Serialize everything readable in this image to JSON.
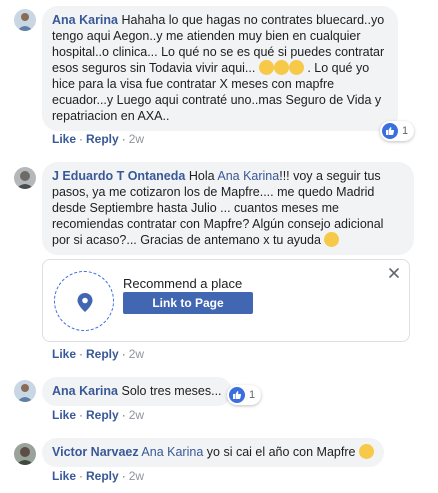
{
  "comments": [
    {
      "author": "Ana Karina",
      "text_a": "Hahaha lo que hagas no contrates bluecard..yo tengo aqui Aegon..y me atienden muy bien en cualquier hospital..o clinica... Lo qué no se es qué si puedes contratar esos seguros sin Todavia vivir aqui...",
      "text_b": ". Lo qué yo hice para la visa fue contratar X meses con mapfre ecuador...y Luego aqui contraté uno..mas Seguro de Vida y repatriacion en AXA..",
      "like_label": "Like",
      "reply_label": "Reply",
      "time": "2w",
      "reaction_count": "1"
    },
    {
      "author": "J Eduardo T Ontaneda",
      "greeting": "Hola",
      "mention": "Ana Karina",
      "text": "!!! voy a seguir tus pasos, ya me cotizaron los de Mapfre.... me quedo Madrid desde Septiembre hasta Julio ... cuantos meses me recomiendas contratar con Mapfre? Algún consejo adicional por si acaso?... Gracias de antemano x tu ayuda"
    },
    {
      "author": "Ana Karina",
      "text": "Solo tres meses...",
      "like_label": "Like",
      "reply_label": "Reply",
      "time": "2w",
      "reaction_count": "1"
    },
    {
      "author": "Victor Narvaez",
      "mention": "Ana Karina",
      "text": "yo si cai el año con Mapfre",
      "like_label": "Like",
      "reply_label": "Reply",
      "time": "2w"
    }
  ],
  "recommend_card": {
    "title": "Recommend a place",
    "button_label": "Link to Page",
    "icons": [
      "map-pin-icon",
      "close-icon"
    ]
  },
  "card_actions": {
    "like_label": "Like",
    "reply_label": "Reply",
    "time": "2w"
  },
  "colors": {
    "link": "#385898",
    "bubble": "#f2f3f5",
    "button": "#4267b2",
    "like": "#3b6fe0"
  }
}
